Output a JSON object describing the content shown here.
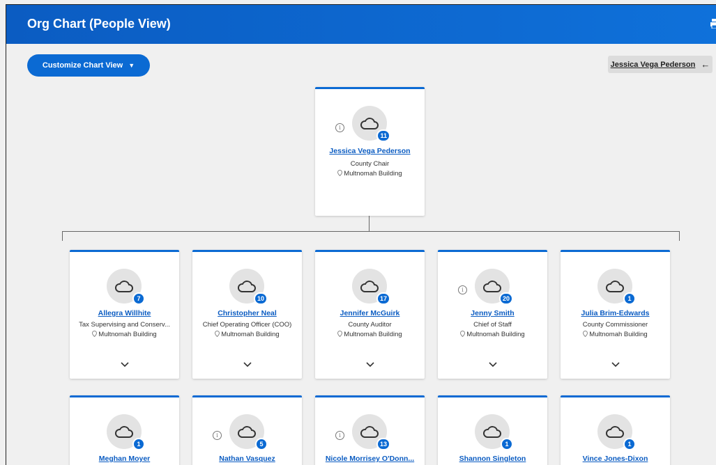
{
  "header": {
    "title": "Org Chart (People View)"
  },
  "toolbar": {
    "customize_label": "Customize Chart View",
    "customize_caret": "▼"
  },
  "nav": {
    "current_person": "Jessica Vega Pederson",
    "back_arrow": "←"
  },
  "root": {
    "name": "Jessica Vega Pederson",
    "title": "County Chair",
    "location": "Multnomah Building",
    "count": "11",
    "info": "i"
  },
  "reports_row1": [
    {
      "name": "Allegra Willhite",
      "title": "Tax Supervising and Conserv...",
      "location": "Multnomah Building",
      "count": "7"
    },
    {
      "name": "Christopher Neal",
      "title": "Chief Operating Officer (COO)",
      "location": "Multnomah Building",
      "count": "10"
    },
    {
      "name": "Jennifer McGuirk",
      "title": "County Auditor",
      "location": "Multnomah Building",
      "count": "17"
    },
    {
      "name": "Jenny Smith",
      "title": "Chief of Staff",
      "location": "Multnomah Building",
      "count": "20",
      "info": "i"
    },
    {
      "name": "Julia Brim-Edwards",
      "title": "County Commissioner",
      "location": "Multnomah Building",
      "count": "1"
    }
  ],
  "reports_row2": [
    {
      "name": "Meghan Moyer",
      "count": "1"
    },
    {
      "name": "Nathan Vasquez",
      "count": "5",
      "info": "i"
    },
    {
      "name": "Nicole Morrisey O'Donn...",
      "count": "13",
      "info": "i"
    },
    {
      "name": "Shannon Singleton",
      "count": "1"
    },
    {
      "name": "Vince Jones-Dixon",
      "count": "1"
    }
  ],
  "colors": {
    "accent": "#0b6ad3",
    "header": "#0f71da",
    "link": "#0b5cc2"
  }
}
